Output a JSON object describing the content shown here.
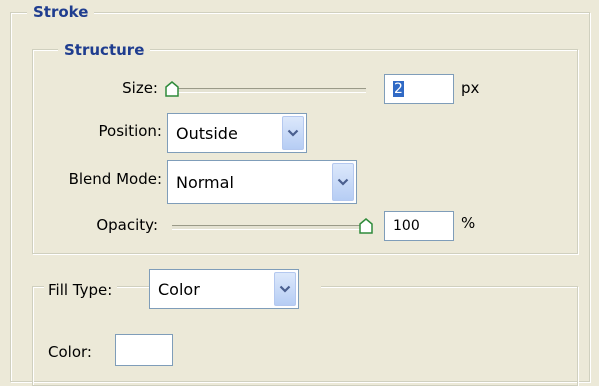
{
  "stroke": {
    "legend": "Stroke",
    "structure": {
      "legend": "Structure",
      "size": {
        "label": "Size:",
        "value": "2",
        "unit": "px",
        "slider_fraction": 0.0
      },
      "position": {
        "label": "Position:",
        "selected": "Outside"
      },
      "blend_mode": {
        "label": "Blend Mode:",
        "selected": "Normal"
      },
      "opacity": {
        "label": "Opacity:",
        "value": "100",
        "unit": "%",
        "slider_fraction": 1.0
      }
    },
    "fill": {
      "fill_type_label": "Fill Type:",
      "fill_type_selected": "Color",
      "color_label": "Color:",
      "color_value": "#ffffff"
    }
  },
  "colors": {
    "legend_text": "#1f3d8f",
    "thumb_outline": "#2e8b3a",
    "thumb_fill": "#ffffff",
    "selection": "#316ac5",
    "field_border": "#7f9db9"
  }
}
